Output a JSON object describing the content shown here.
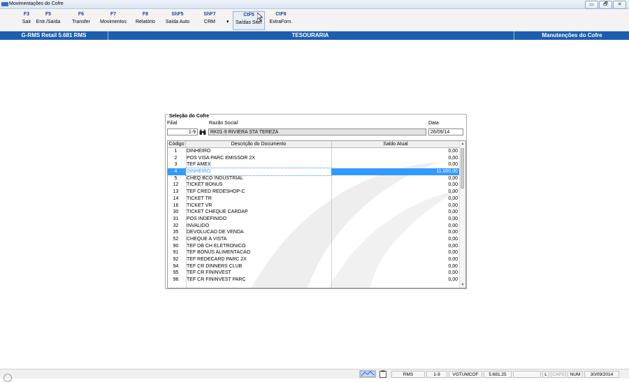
{
  "window": {
    "title": "Movimentações do Cofre",
    "controls": [
      "▭",
      "🗗",
      "✕"
    ]
  },
  "toolbar": {
    "buttons": [
      {
        "key": "F3",
        "label": "Sair"
      },
      {
        "key": "F5",
        "label": "Entr./Saída"
      },
      {
        "key": "F6",
        "label": "Transfer"
      },
      {
        "key": "F7",
        "label": "Movimentos"
      },
      {
        "key": "F8",
        "label": "Relatório"
      },
      {
        "key": "ShF5",
        "label": "Saída Auto"
      },
      {
        "key": "ShF7",
        "label": "CRM"
      },
      {
        "key": "CtF5",
        "label": "Saídas Sitef"
      },
      {
        "key": "CtF6",
        "label": "ExtraForn."
      }
    ],
    "dropdown_glyph": "▾"
  },
  "header": {
    "left": "G-RMS Retail 5.681 RMS",
    "center": "TESOURARIA",
    "right": "Manutenções do Cofre"
  },
  "panel": {
    "legend": "Seleção do Cofre",
    "filial_label": "Filial",
    "filial_value": "1-9",
    "razao_label": "Razão Social",
    "razao_value": "RK01-9 RIVIERA STA TEREZA",
    "data_label": "Data",
    "data_value": "26/09/14"
  },
  "grid": {
    "headers": {
      "code": "Código",
      "desc": "Descrição do Documento",
      "balance": "Saldo Atual"
    },
    "rows": [
      {
        "code": "1",
        "desc": "DINHEIRO",
        "balance": "0,00"
      },
      {
        "code": "2",
        "desc": "POS VISA PARC EMISSOR 2X",
        "balance": "0,00"
      },
      {
        "code": "3",
        "desc": "TEF AMEX",
        "balance": "0,00"
      },
      {
        "code": "4",
        "desc": "DINHEIRO",
        "balance": "11.000,00",
        "selected": true
      },
      {
        "code": "5",
        "desc": "CHEQ BCO INDUSTRIAL",
        "balance": "0,00"
      },
      {
        "code": "12",
        "desc": "TICKET BONUS",
        "balance": "0,00"
      },
      {
        "code": "13",
        "desc": "TEF CRED REDESHOP-C",
        "balance": "0,00"
      },
      {
        "code": "14",
        "desc": "TICKET TR",
        "balance": "0,00"
      },
      {
        "code": "16",
        "desc": "TICKET VR",
        "balance": "0,00"
      },
      {
        "code": "30",
        "desc": "TICKET CHEQUE CARDAP",
        "balance": "0,00"
      },
      {
        "code": "31",
        "desc": "POS INDEFINIDO",
        "balance": "0,00"
      },
      {
        "code": "32",
        "desc": "INVALIDO",
        "balance": "0,00"
      },
      {
        "code": "35",
        "desc": "DEVOLUCAO DE VENDA",
        "balance": "0,00"
      },
      {
        "code": "52",
        "desc": "CHEQUE A VISTA",
        "balance": "0,00"
      },
      {
        "code": "90",
        "desc": "TEF DB CH ELETRONICO",
        "balance": "0,00"
      },
      {
        "code": "91",
        "desc": "TEF BONUS ALIMENTACAO",
        "balance": "0,00"
      },
      {
        "code": "92",
        "desc": "TEF REDECARD PARC 2X",
        "balance": "0,00"
      },
      {
        "code": "94",
        "desc": "TEF CR DINNERS CLUB",
        "balance": "0,00"
      },
      {
        "code": "95",
        "desc": "TEF CR FININVEST",
        "balance": "0,00"
      },
      {
        "code": "96",
        "desc": "TEF CR FININVEST PARC",
        "balance": "0,00"
      }
    ],
    "scroll": {
      "up": "▲",
      "down": "▼"
    }
  },
  "statusbar": {
    "system": "RMS",
    "filial": "1-9",
    "program": "VGTUMCOF",
    "version": "5.681.25",
    "empty": "",
    "lock_l": "L",
    "caps": "CAPS",
    "num": "NUM",
    "date": "30/09/2014"
  },
  "colors": {
    "header_blue": "#1c5eb0",
    "selection_blue": "#3399ff",
    "key_blue": "#1f3f8f"
  }
}
